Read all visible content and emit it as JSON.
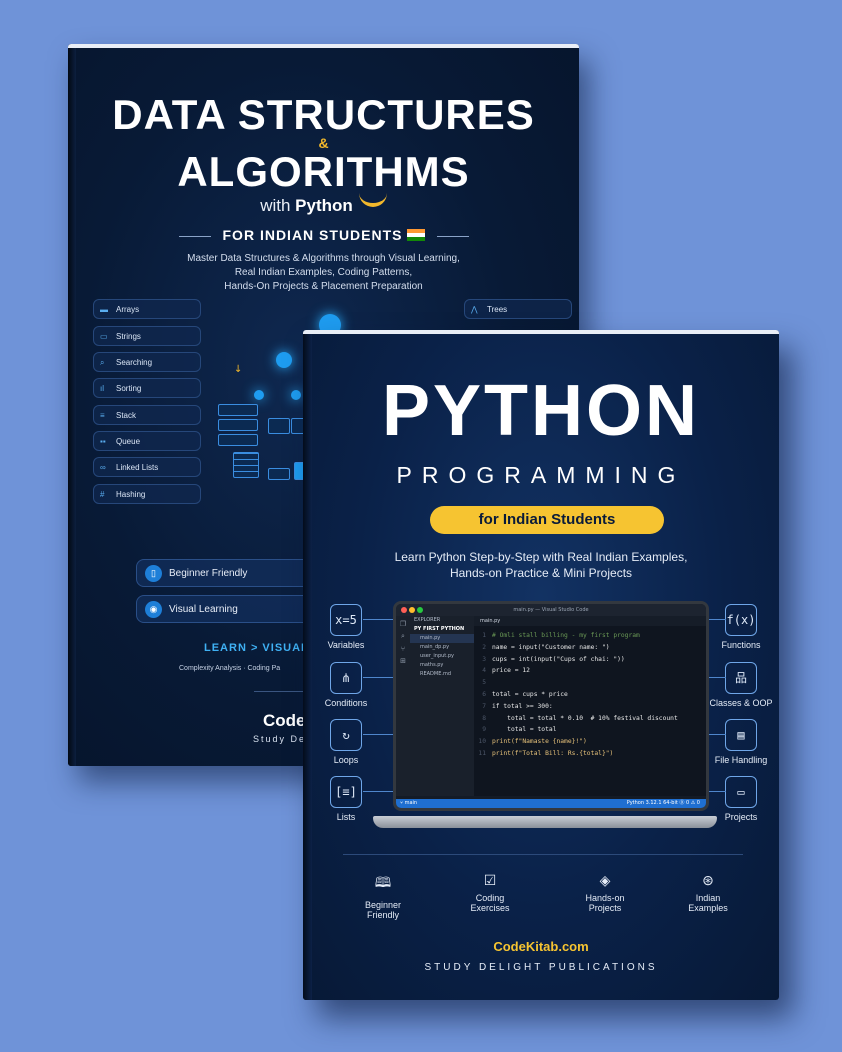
{
  "dsa_book": {
    "title_line1": "DATA STRUCTURES",
    "ampersand": "&",
    "title_line2": "ALGORITHMS",
    "with_text": "with",
    "language": "Python",
    "tagline": "FOR INDIAN STUDENTS",
    "description": [
      "Master Data Structures & Algorithms through Visual Learning,",
      "Real Indian Examples, Coding Patterns,",
      "Hands-On Projects & Placement Preparation"
    ],
    "topics_left": [
      {
        "icon": "arrays-icon",
        "label": "Arrays"
      },
      {
        "icon": "strings-icon",
        "label": "Strings"
      },
      {
        "icon": "search-icon",
        "label": "Searching"
      },
      {
        "icon": "sorting-icon",
        "label": "Sorting"
      },
      {
        "icon": "stack-icon",
        "label": "Stack"
      },
      {
        "icon": "queue-icon",
        "label": "Queue"
      },
      {
        "icon": "linked-list-icon",
        "label": "Linked Lists"
      },
      {
        "icon": "hash-icon",
        "label": "Hashing"
      }
    ],
    "topics_right": [
      {
        "icon": "tree-icon",
        "label": "Trees"
      }
    ],
    "pills": [
      {
        "icon": "book-icon",
        "label": "Beginner Friendly"
      },
      {
        "icon": "eye-icon",
        "label": "Visual Learning"
      }
    ],
    "learn_line": "LEARN > VISUALIZ",
    "complexity_line": "Complexity Analysis · Coding Pa",
    "brand": "CodeK",
    "brand_sub": "Study De"
  },
  "python_book": {
    "title": "PYTHON",
    "subtitle": "PROGRAMMING",
    "badge": "for Indian Students",
    "description": [
      "Learn Python Step-by-Step with Real Indian Examples,",
      "Hands-on Practice & Mini Projects"
    ],
    "left_features": [
      {
        "icon": "variables-icon",
        "glyph": "x=5",
        "label": "Variables"
      },
      {
        "icon": "conditions-icon",
        "glyph": "⋔",
        "label": "Conditions"
      },
      {
        "icon": "loops-icon",
        "glyph": "↻",
        "label": "Loops"
      },
      {
        "icon": "lists-icon",
        "glyph": "[≡]",
        "label": "Lists"
      }
    ],
    "right_features": [
      {
        "icon": "functions-icon",
        "glyph": "f(x)",
        "label": "Functions"
      },
      {
        "icon": "classes-icon",
        "glyph": "品",
        "label": "Classes & OOP"
      },
      {
        "icon": "file-icon",
        "glyph": "▤",
        "label": "File Handling"
      },
      {
        "icon": "projects-icon",
        "glyph": "▭",
        "label": "Projects"
      }
    ],
    "editor": {
      "window_title": "main.py — Visual Studio Code",
      "explorer_header": "EXPLORER",
      "project": "PY FIRST PYTHON",
      "files": [
        "main.py",
        "main_dp.py",
        "user_input.py",
        "maths.py",
        "README.md"
      ],
      "tab": "main.py",
      "code_lines": [
        {
          "n": "1",
          "text": "# Omli stall billing - my first program"
        },
        {
          "n": "2",
          "text": "name = input(\"Customer name: \")"
        },
        {
          "n": "3",
          "text": "cups = int(input(\"Cups of chai: \"))"
        },
        {
          "n": "4",
          "text": "price = 12"
        },
        {
          "n": "5",
          "text": ""
        },
        {
          "n": "6",
          "text": "total = cups * price"
        },
        {
          "n": "7",
          "text": "if total >= 300:"
        },
        {
          "n": "8",
          "text": "    total = total * 0.10  # 10% festival discount"
        },
        {
          "n": "9",
          "text": "    total = total"
        },
        {
          "n": "10",
          "text": "print(f\"Namaste {name}!\")"
        },
        {
          "n": "11",
          "text": "print(f\"Total Bill: Rs.{total}\")"
        }
      ],
      "status_left": "⑂ main",
      "status_right": "Python 3.12.1 64-bit  ⓪ 0 ⚠ 0"
    },
    "bottom_features": [
      {
        "icon": "book-open-icon",
        "glyph": "🕮",
        "label1": "Beginner",
        "label2": "Friendly"
      },
      {
        "icon": "checkbox-icon",
        "glyph": "☑",
        "label1": "Coding",
        "label2": "Exercises"
      },
      {
        "icon": "layers-icon",
        "glyph": "◈",
        "label1": "Hands-on",
        "label2": "Projects"
      },
      {
        "icon": "compass-icon",
        "glyph": "⊛",
        "label1": "Indian",
        "label2": "Examples"
      }
    ],
    "website": "CodeKitab.com",
    "publisher": "STUDY DELIGHT PUBLICATIONS"
  },
  "colors": {
    "background": "#6f93d8",
    "accent_yellow": "#f6c431",
    "accent_blue": "#1e9cf0",
    "cover_navy": "#0a2148"
  }
}
